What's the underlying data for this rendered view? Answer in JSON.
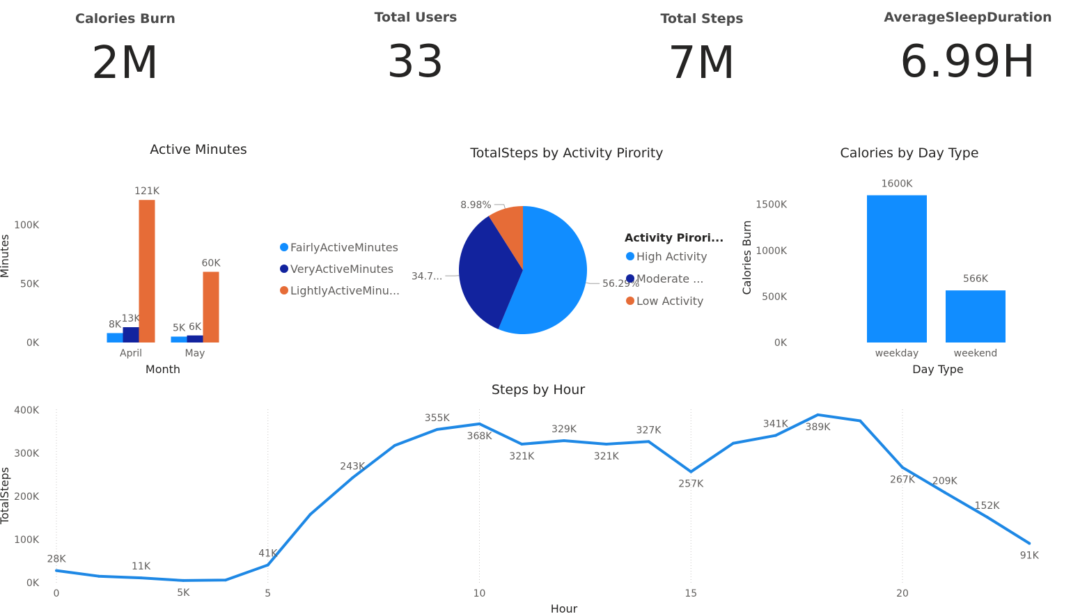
{
  "cards": [
    {
      "label": "Calories Burn",
      "value": "2M"
    },
    {
      "label": "Total Users",
      "value": "33"
    },
    {
      "label": "Total Steps",
      "value": "7M"
    },
    {
      "label": "AverageSleepDuration",
      "value": "6.99H"
    }
  ],
  "colors": {
    "light_blue": "#118DFF",
    "dark_blue": "#12239E",
    "orange": "#E66C37",
    "line": "#1E88E5"
  },
  "chart_data": [
    {
      "type": "bar",
      "title": "Active Minutes",
      "xlabel": "Month",
      "ylabel": "Minutes",
      "categories": [
        "April",
        "May"
      ],
      "yticks": [
        "0K",
        "50K",
        "100K"
      ],
      "ylim": [
        0,
        130000
      ],
      "series": [
        {
          "name": "FairlyActiveMinutes",
          "color": "#118DFF",
          "values": [
            8000,
            5000
          ],
          "labels": [
            "8K",
            "5K"
          ]
        },
        {
          "name": "VeryActiveMinutes",
          "color": "#12239E",
          "values": [
            13000,
            6000
          ],
          "labels": [
            "13K",
            "6K"
          ]
        },
        {
          "name": "LightlyActiveMinu...",
          "color": "#E66C37",
          "values": [
            121000,
            60000
          ],
          "labels": [
            "121K",
            "60K"
          ]
        }
      ],
      "legend": "right"
    },
    {
      "type": "pie",
      "title": "TotalSteps by Activity Pirority",
      "legend_title": "Activity Pirori...",
      "slices": [
        {
          "name": "High Activity",
          "value": 56.29,
          "label": "56.29%",
          "color": "#118DFF"
        },
        {
          "name": "Moderate ...",
          "value": 34.73,
          "label": "34.7...",
          "color": "#12239E"
        },
        {
          "name": "Low Activity",
          "value": 8.98,
          "label": "8.98%",
          "color": "#E66C37"
        }
      ],
      "legend": "right"
    },
    {
      "type": "bar",
      "title": "Calories by Day Type",
      "xlabel": "Day Type",
      "ylabel": "Calories Burn",
      "categories": [
        "weekday",
        "weekend"
      ],
      "values": [
        1600000,
        566000
      ],
      "labels": [
        "1600K",
        "566K"
      ],
      "yticks": [
        "0K",
        "500K",
        "1000K",
        "1500K"
      ],
      "ylim": [
        0,
        1700000
      ],
      "color": "#118DFF"
    },
    {
      "type": "line",
      "title": "Steps by Hour",
      "xlabel": "Hour",
      "ylabel": "TotalSteps",
      "x": [
        0,
        1,
        2,
        3,
        4,
        5,
        6,
        7,
        8,
        9,
        10,
        11,
        12,
        13,
        14,
        15,
        16,
        17,
        18,
        19,
        20,
        21,
        22,
        23
      ],
      "y": [
        28000,
        15000,
        11000,
        5000,
        6000,
        41000,
        158000,
        243000,
        318000,
        355000,
        368000,
        321000,
        329000,
        321000,
        327000,
        257000,
        323000,
        341000,
        389000,
        375000,
        267000,
        209000,
        152000,
        91000
      ],
      "labels": [
        "28K",
        "",
        "11K",
        "5K",
        "",
        "41K",
        "",
        "243K",
        "",
        "355K",
        "368K",
        "321K",
        "329K",
        "321K",
        "327K",
        "257K",
        "",
        "341K",
        "389K",
        "",
        "267K",
        "209K",
        "152K",
        "91K"
      ],
      "xticks": [
        "0",
        "5",
        "10",
        "15",
        "20"
      ],
      "yticks": [
        "0K",
        "100K",
        "200K",
        "300K",
        "400K"
      ],
      "xlim": [
        0,
        23
      ],
      "ylim": [
        0,
        400000
      ],
      "grid": "vertical dotted"
    }
  ]
}
